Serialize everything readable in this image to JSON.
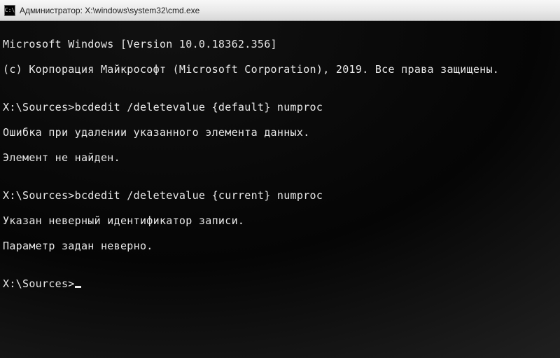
{
  "window": {
    "title": "Администратор: X:\\windows\\system32\\cmd.exe"
  },
  "terminal": {
    "version_line": "Microsoft Windows [Version 10.0.18362.356]",
    "copyright_line": "(c) Корпорация Майкрософт (Microsoft Corporation), 2019. Все права защищены.",
    "blank": "",
    "block1": {
      "prompt_cmd": "X:\\Sources>bcdedit /deletevalue {default} numproc",
      "err1": "Ошибка при удалении указанного элемента данных.",
      "err2": "Элемент не найден."
    },
    "block2": {
      "prompt_cmd": "X:\\Sources>bcdedit /deletevalue {current} numproc",
      "err1": "Указан неверный идентификатор записи.",
      "err2": "Параметр задан неверно."
    },
    "prompt_current": "X:\\Sources>"
  }
}
